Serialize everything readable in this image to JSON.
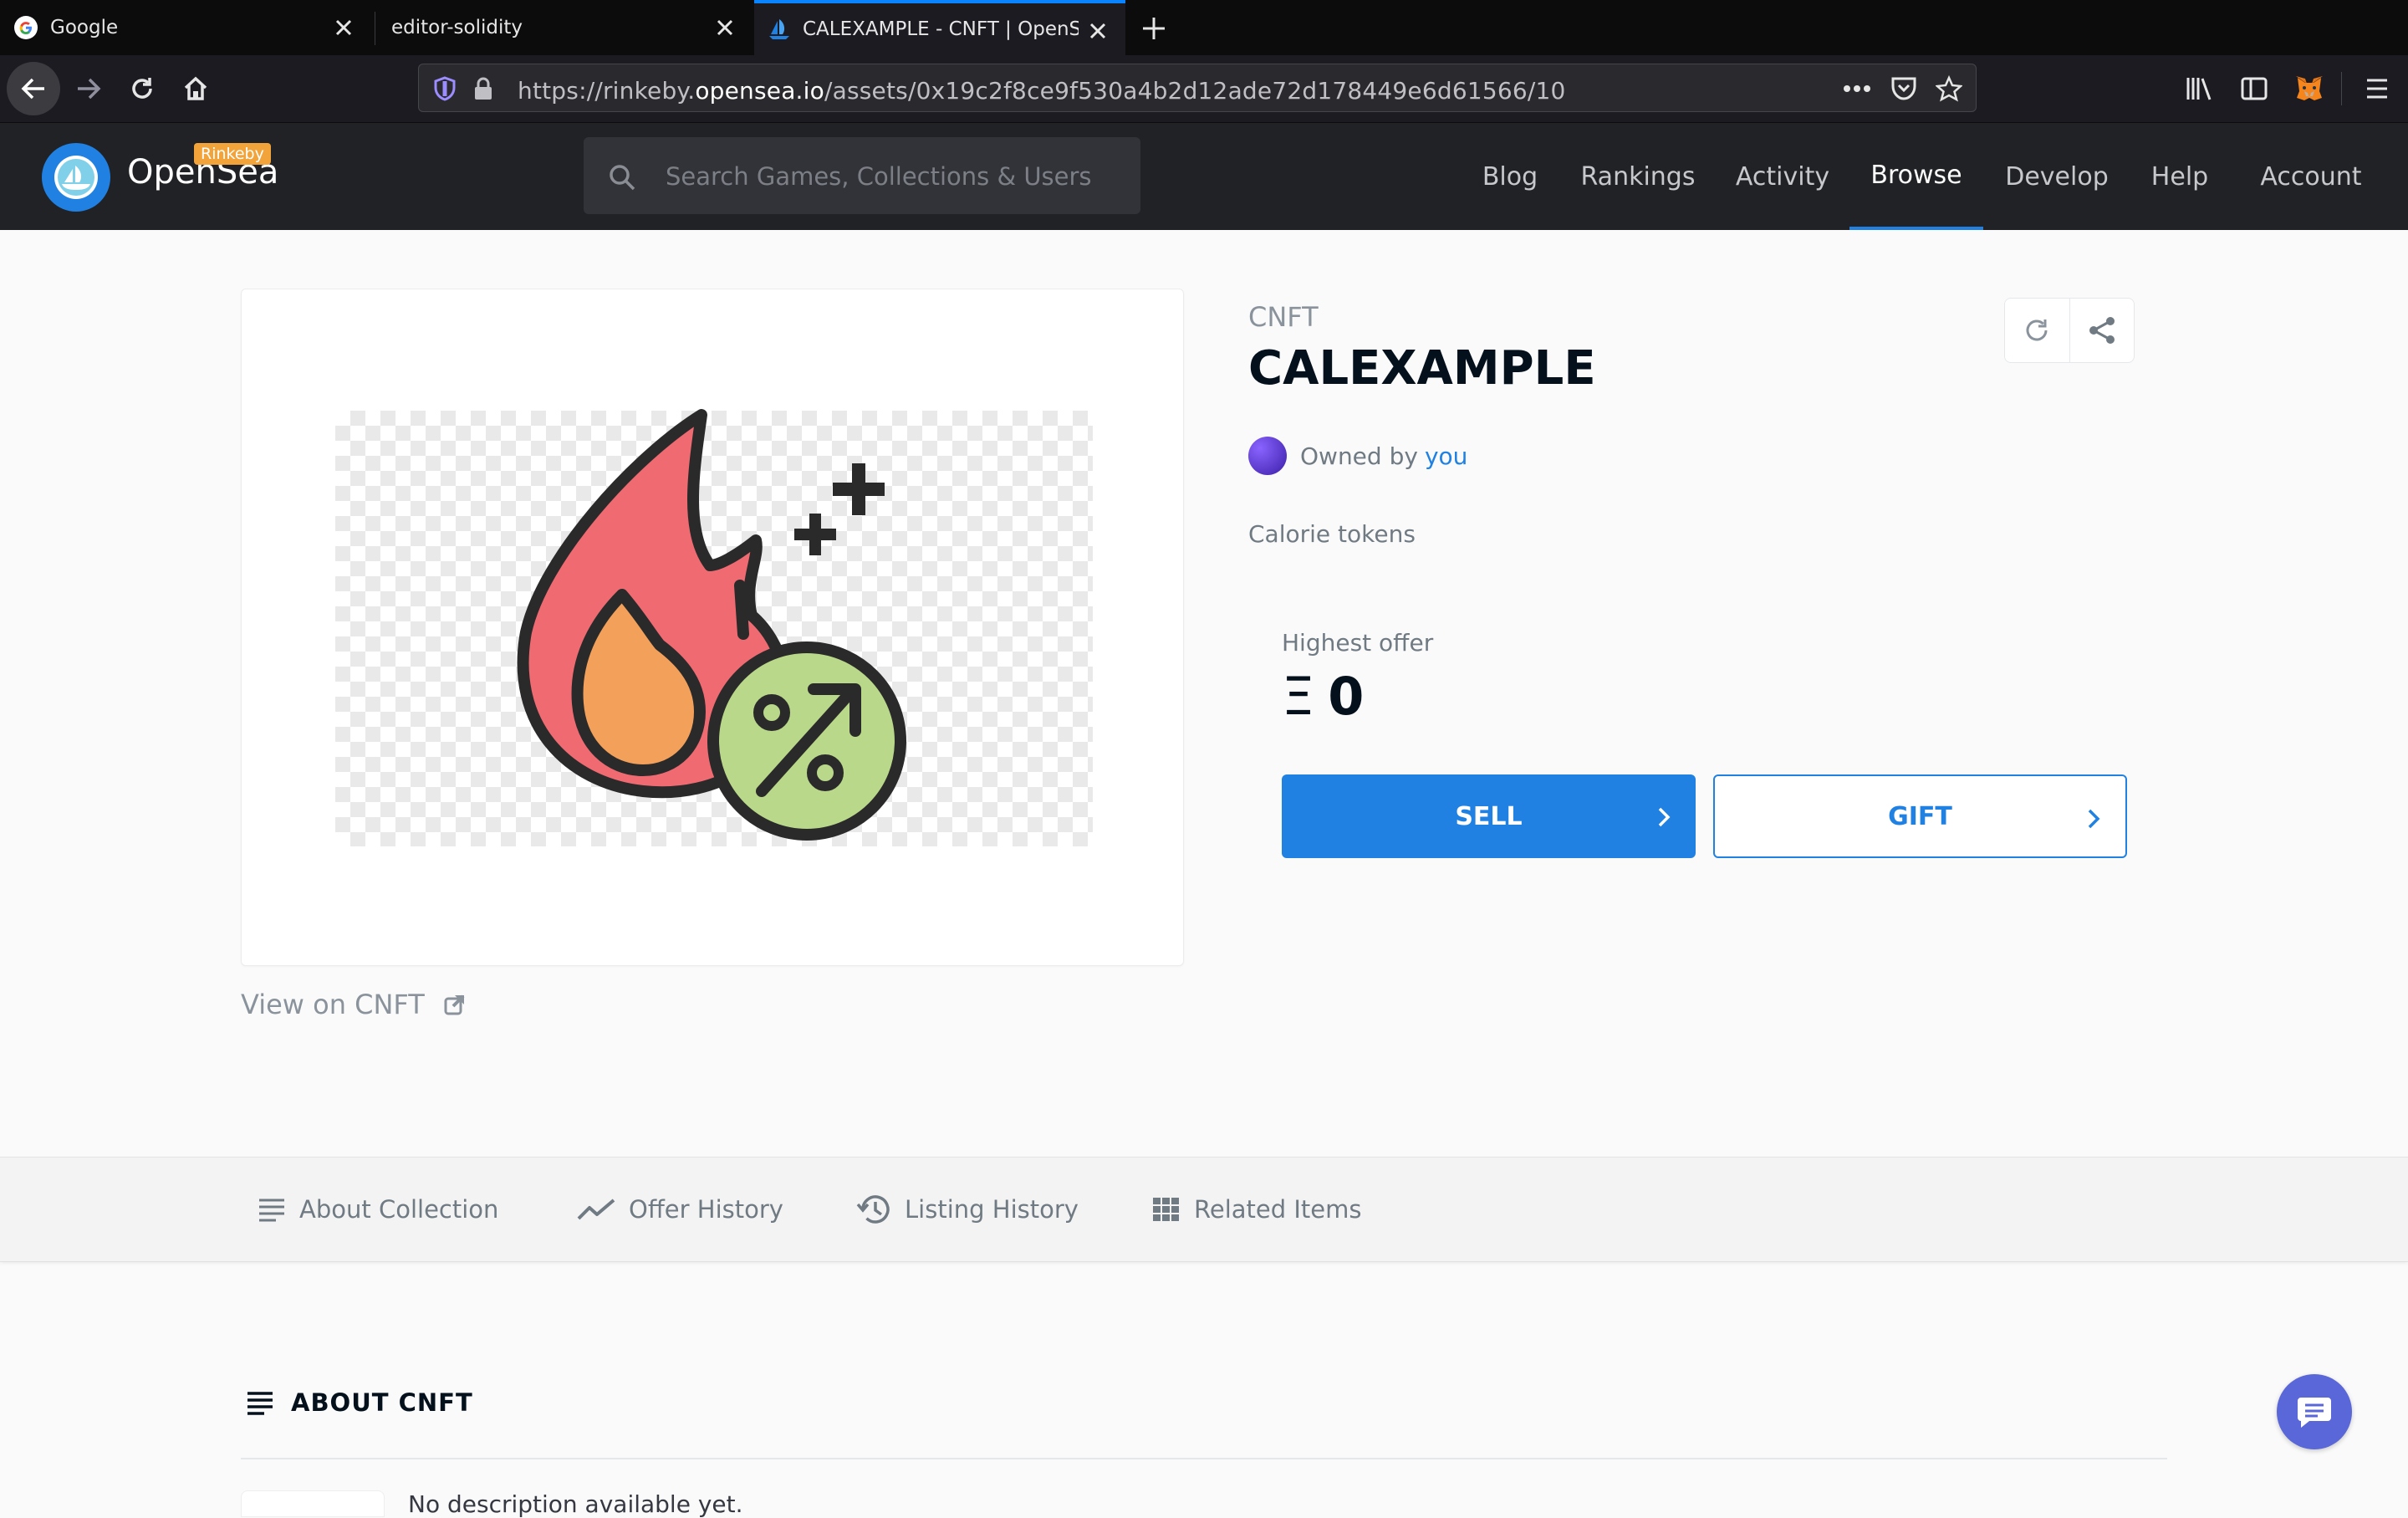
{
  "browser": {
    "tabs": [
      {
        "title": "Google",
        "active": false
      },
      {
        "title": "editor-solidity",
        "active": false
      },
      {
        "title": "CALEXAMPLE - CNFT | OpenSe",
        "active": true
      }
    ],
    "url_prefix": "https://rinkeby.",
    "url_domain": "opensea.io",
    "url_path": "/assets/0x19c2f8ce9f530a4b2d12ade72d178449e6d61566/10"
  },
  "site": {
    "brand": "OpenSea",
    "network_badge": "Rinkeby",
    "search_placeholder": "Search Games, Collections & Users",
    "nav": [
      {
        "label": "Blog",
        "active": false
      },
      {
        "label": "Rankings",
        "active": false
      },
      {
        "label": "Activity",
        "active": false
      },
      {
        "label": "Browse",
        "active": true
      },
      {
        "label": "Develop",
        "active": false
      },
      {
        "label": "Help",
        "active": false
      },
      {
        "label": "Account",
        "active": false
      }
    ]
  },
  "asset": {
    "collection": "CNFT",
    "name": "CALEXAMPLE",
    "owned_by_label": "Owned by",
    "owner": "you",
    "description": "Calorie tokens",
    "view_on_label": "View on CNFT",
    "highest_offer_label": "Highest offer",
    "highest_offer_currency": "Ξ",
    "highest_offer_value": "0",
    "sell_label": "SELL",
    "gift_label": "GIFT"
  },
  "section_tabs": {
    "about_collection": "About Collection",
    "offer_history": "Offer History",
    "listing_history": "Listing History",
    "related_items": "Related Items"
  },
  "about": {
    "heading": "ABOUT CNFT",
    "text": "No description available yet."
  },
  "colors": {
    "accent": "#2081e2",
    "header_bg": "#202225",
    "badge": "#f2a33a",
    "flame_outer": "#f06a72",
    "flame_inner": "#f3a05a",
    "badge_green": "#b9d889"
  }
}
